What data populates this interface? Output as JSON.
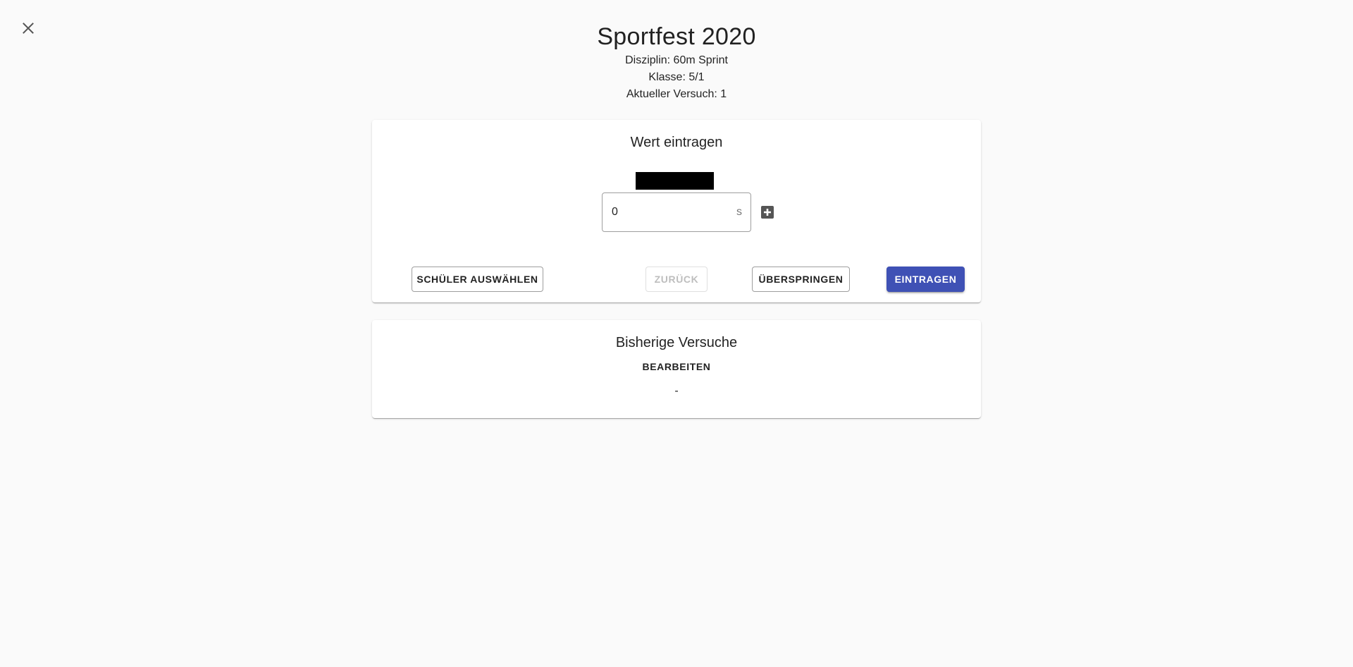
{
  "header": {
    "title": "Sportfest 2020",
    "discipline": "Disziplin: 60m Sprint",
    "class": "Klasse: 5/1",
    "attempt": "Aktueller Versuch: 1"
  },
  "close_icon": "close-icon",
  "entry_card": {
    "title": "Wert eintragen",
    "value_input": {
      "value": "0",
      "unit": "s"
    },
    "add_icon": "plus-box-icon",
    "buttons": {
      "select_student": "SCHÜLER AUSWÄHLEN",
      "back": "ZURÜCK",
      "skip": "ÜBERSPRINGEN",
      "submit": "EINTRAGEN"
    },
    "accent_color": "#3f51b5"
  },
  "attempts_card": {
    "title": "Bisherige Versuche",
    "edit_label": "BEARBEITEN",
    "empty_value": "-"
  }
}
